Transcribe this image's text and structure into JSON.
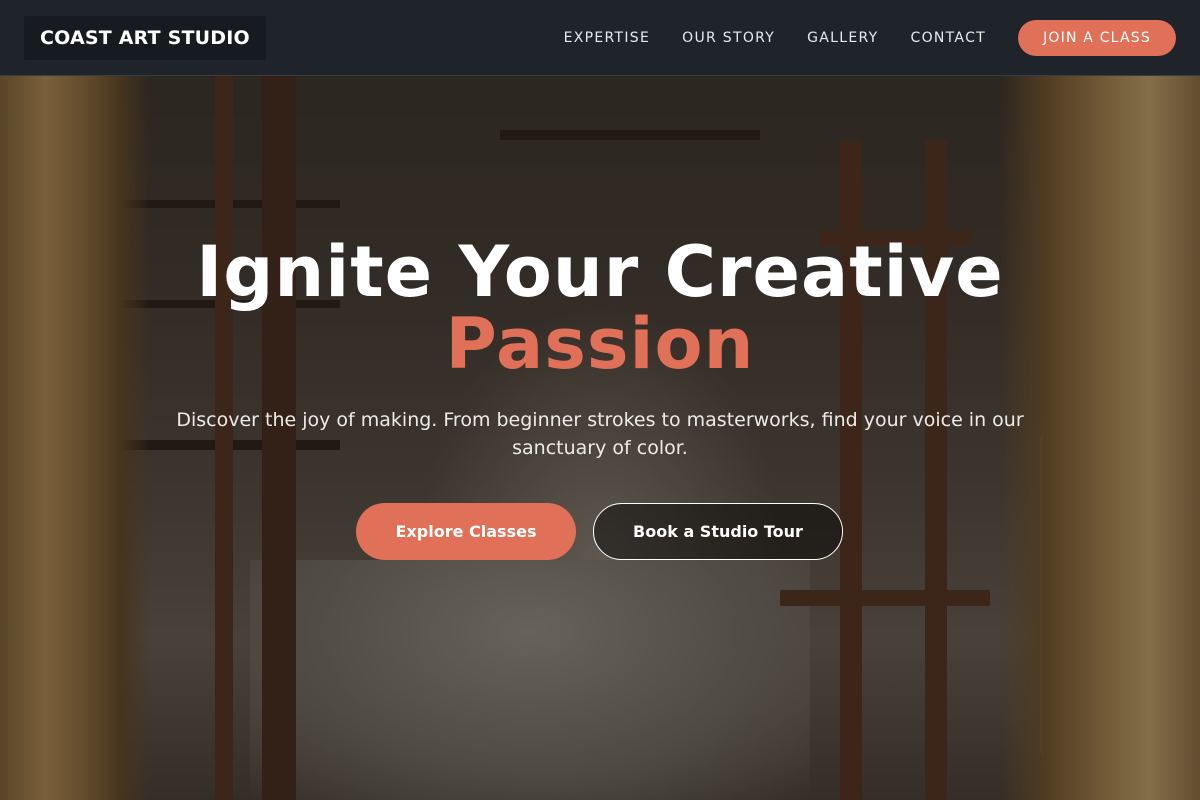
{
  "navbar": {
    "brand": "COAST ART STUDIO",
    "links": [
      "EXPERTISE",
      "OUR STORY",
      "GALLERY",
      "CONTACT"
    ],
    "cta_label": "JOIN A CLASS"
  },
  "hero": {
    "headline_line1": "Ignite Your Creative",
    "headline_line2": "Passion",
    "subtext": "Discover the joy of making. From beginner strokes to masterworks, find your voice in our sanctuary of color.",
    "primary_button": "Explore Classes",
    "secondary_button": "Book a Studio Tour"
  },
  "colors": {
    "accent": "#e07058",
    "navbar_bg": "#1f242b",
    "text": "#ffffff"
  }
}
